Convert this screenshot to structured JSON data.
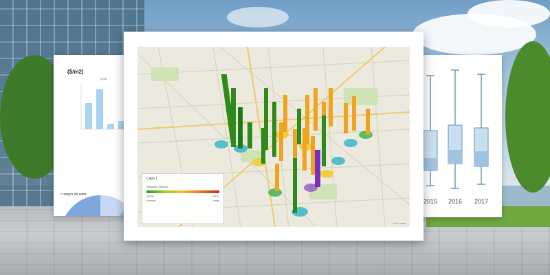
{
  "left_card": {
    "title": "($/m2)",
    "year": "2015",
    "pie_title": "r rangos de valor"
  },
  "right_card": {
    "years": [
      "2015",
      "2016",
      "2017"
    ]
  },
  "map": {
    "legend": {
      "layer": "Capa 1",
      "measure": "Variacion (Media)",
      "min": "102.00",
      "max": "122.27",
      "min_note": "o menos",
      "max_note": "o más"
    },
    "credit": "© 2017 HERE"
  },
  "colors": {
    "green": "#2f8a1c",
    "orange": "#f0a41e",
    "purple": "#7b2cc4",
    "pie_dark": "#2a6db5",
    "pie_light": "#b8cfee",
    "box_fill": "#c8dff0"
  }
}
